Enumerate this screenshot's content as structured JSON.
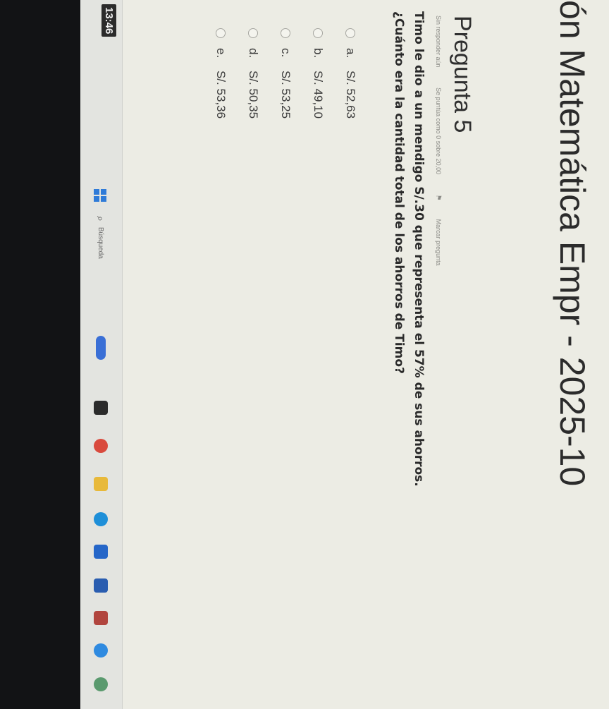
{
  "page": {
    "course_title": "ón Matemática Empr - 2025-10",
    "question_heading": "Pregunta 5",
    "meta": {
      "status": "Sin responder aún",
      "points": "Se puntúa como 0 sobre 20,00",
      "flag_label": "Marcar pregunta"
    },
    "question_text": "Timo le dio a un mendigo S/.30 que representa el 57% de sus ahorros. ¿Cuánto era la cantidad total de los ahorros de Timo?",
    "options": [
      {
        "letter": "a.",
        "text": "S/. 52,63"
      },
      {
        "letter": "b.",
        "text": "S/. 49,10"
      },
      {
        "letter": "c.",
        "text": "S/. 53,25"
      },
      {
        "letter": "d.",
        "text": "S/. 50,35"
      },
      {
        "letter": "e.",
        "text": "S/. 53,36"
      }
    ]
  },
  "taskbar": {
    "clock": "13:46",
    "search_label": "Búsqueda",
    "icons": [
      {
        "name": "widgets-icon",
        "color": "#3a6fd6"
      },
      {
        "name": "file-explorer-icon",
        "color": "#2b2b2b"
      },
      {
        "name": "chrome-icon",
        "color": "#d94a3d"
      },
      {
        "name": "folder-icon",
        "color": "#e8b93a"
      },
      {
        "name": "edge-icon",
        "color": "#1e8fd8"
      },
      {
        "name": "store-icon",
        "color": "#2566c8"
      },
      {
        "name": "word-icon",
        "color": "#2a5db0"
      },
      {
        "name": "teams-icon",
        "color": "#b1453e"
      },
      {
        "name": "app-icon",
        "color": "#2f8ae0"
      },
      {
        "name": "weather-icon",
        "color": "#5a9a6e"
      }
    ]
  }
}
